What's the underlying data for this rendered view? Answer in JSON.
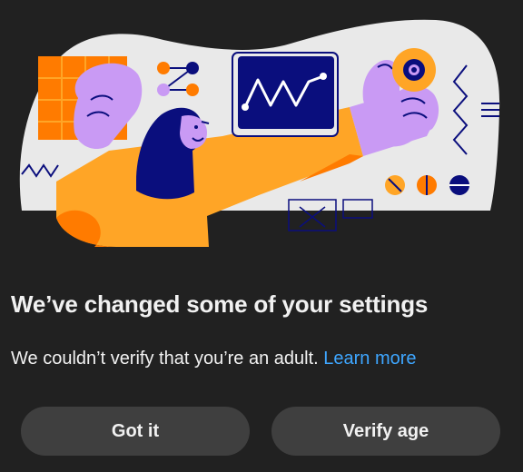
{
  "dialog": {
    "title": "We’ve changed some of your settings",
    "message": "We couldn’t verify that you’re an adult.",
    "learn_more": "Learn more",
    "buttons": {
      "got_it": "Got it",
      "verify_age": "Verify age"
    }
  },
  "colors": {
    "background": "#212121",
    "text": "#f1f1f1",
    "link": "#3ea6ff",
    "button": "#3f3f3f",
    "blob": "#e9e9e9",
    "orange": "#ffa526",
    "dark_orange": "#ff7b00",
    "lavender": "#c99af4",
    "navy": "#0a0e7d"
  },
  "illustration": {
    "subject": "person-with-tech-devices-illustration"
  }
}
